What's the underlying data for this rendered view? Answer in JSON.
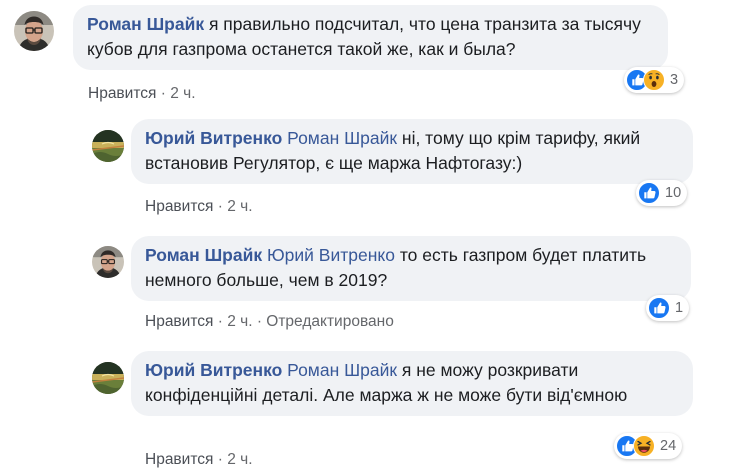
{
  "comments": [
    {
      "author": "Роман Шрайк",
      "mention": "",
      "text": " я правильно подсчитал, что цена транзита за тысячу кубов для газпрома останется такой же, как и была?",
      "like_label": "Нравится",
      "time": "2 ч.",
      "edited": "",
      "reaction_count": "3",
      "reactions": [
        "like-icon",
        "wow-icon"
      ]
    },
    {
      "author": "Юрий Витренко",
      "mention": "Роман Шрайк",
      "text": " ні, тому що крім тарифу, який встановив Регулятор, є ще маржа Нафтогазу:)",
      "like_label": "Нравится",
      "time": "2 ч.",
      "edited": "",
      "reaction_count": "10",
      "reactions": [
        "like-icon"
      ]
    },
    {
      "author": "Роман Шрайк",
      "mention": "Юрий Витренко",
      "text": " то есть газпром будет платить немного больше, чем в 2019?",
      "like_label": "Нравится",
      "time": "2 ч.",
      "edited": "Отредактировано",
      "reaction_count": "1",
      "reactions": [
        "like-icon"
      ]
    },
    {
      "author": "Юрий Витренко",
      "mention": "Роман Шрайк",
      "text": " я не можу розкривати конфіденційні деталі. Але маржа ж не може бути від'ємною",
      "like_label": "Нравится",
      "time": "2 ч.",
      "edited": "",
      "reaction_count": "24",
      "reactions": [
        "like-icon",
        "haha-icon"
      ]
    }
  ],
  "colors": {
    "author": "#385898",
    "bubble": "#f0f2f5",
    "like_blue": "#1877f2",
    "emoji_yellow": "#f7b125"
  }
}
